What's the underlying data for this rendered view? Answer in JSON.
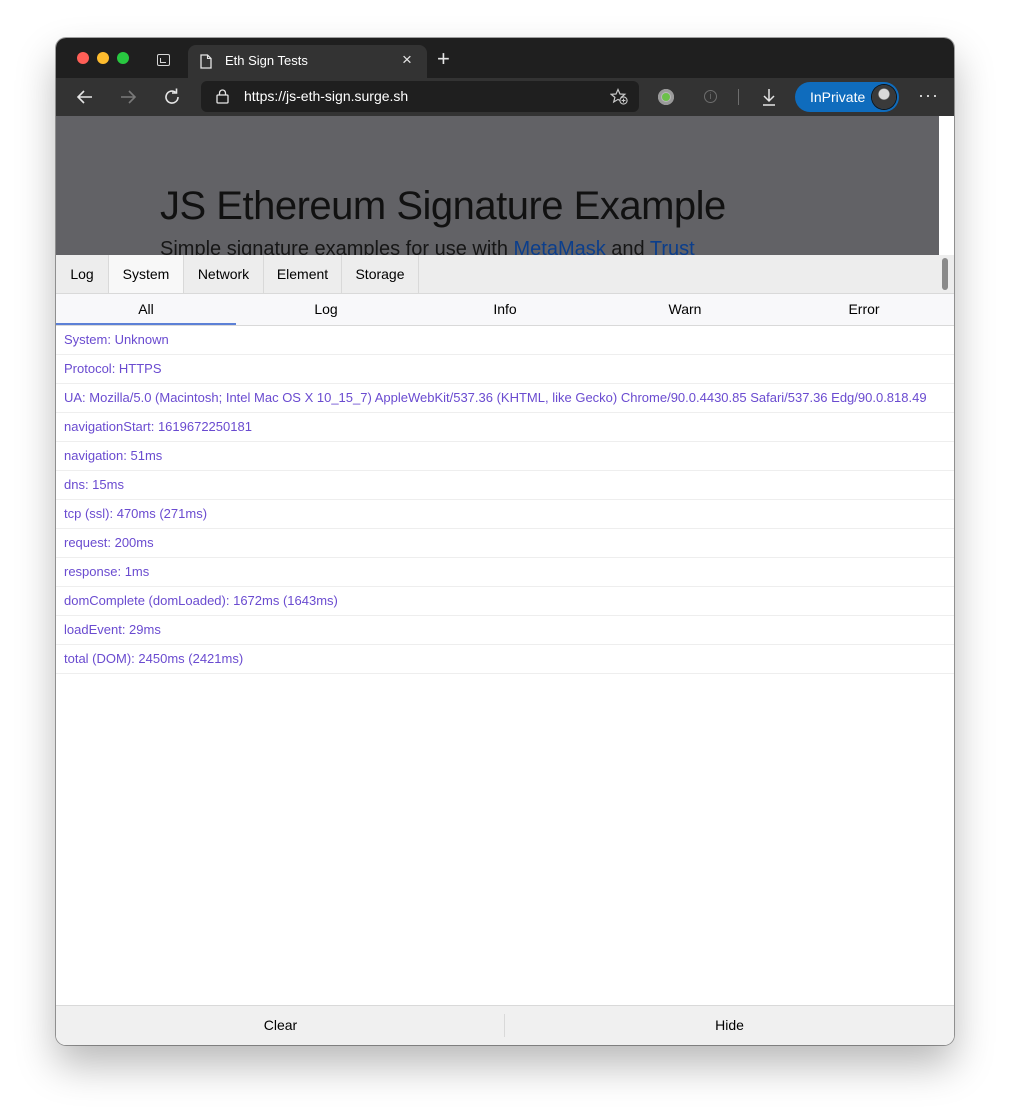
{
  "browser": {
    "tab_title": "Eth Sign Tests",
    "url_scheme": "https://",
    "url_host": "js-eth-sign.surge.sh",
    "inprivate_label": "InPrivate",
    "more_label": "···",
    "new_tab_label": "+",
    "close_label": "×"
  },
  "page": {
    "title": "JS Ethereum Signature Example",
    "subtitle_prefix": "Simple signature examples for use with ",
    "link_metamask": "MetaMask",
    "subtitle_and": " and ",
    "link_trust": "Trust"
  },
  "console": {
    "tabs": [
      "Log",
      "System",
      "Network",
      "Element",
      "Storage"
    ],
    "active_tab": "System",
    "subtabs": [
      "All",
      "Log",
      "Info",
      "Warn",
      "Error"
    ],
    "active_subtab": "All",
    "rows": [
      "System: Unknown",
      "Protocol: HTTPS",
      "UA: Mozilla/5.0 (Macintosh; Intel Mac OS X 10_15_7) AppleWebKit/537.36 (KHTML, like Gecko) Chrome/90.0.4430.85 Safari/537.36 Edg/90.0.818.49",
      "navigationStart: 1619672250181",
      "navigation: 51ms",
      "dns: 15ms",
      "tcp (ssl): 470ms (271ms)",
      "request: 200ms",
      "response: 1ms",
      "domComplete (domLoaded): 1672ms (1643ms)",
      "loadEvent: 29ms",
      "total (DOM): 2450ms (2421ms)"
    ],
    "clear_label": "Clear",
    "hide_label": "Hide"
  },
  "colors": {
    "log_text": "#6a4bd0",
    "inprivate_bg": "#0f6cbd",
    "active_subtab_underline": "#5c80d6"
  }
}
